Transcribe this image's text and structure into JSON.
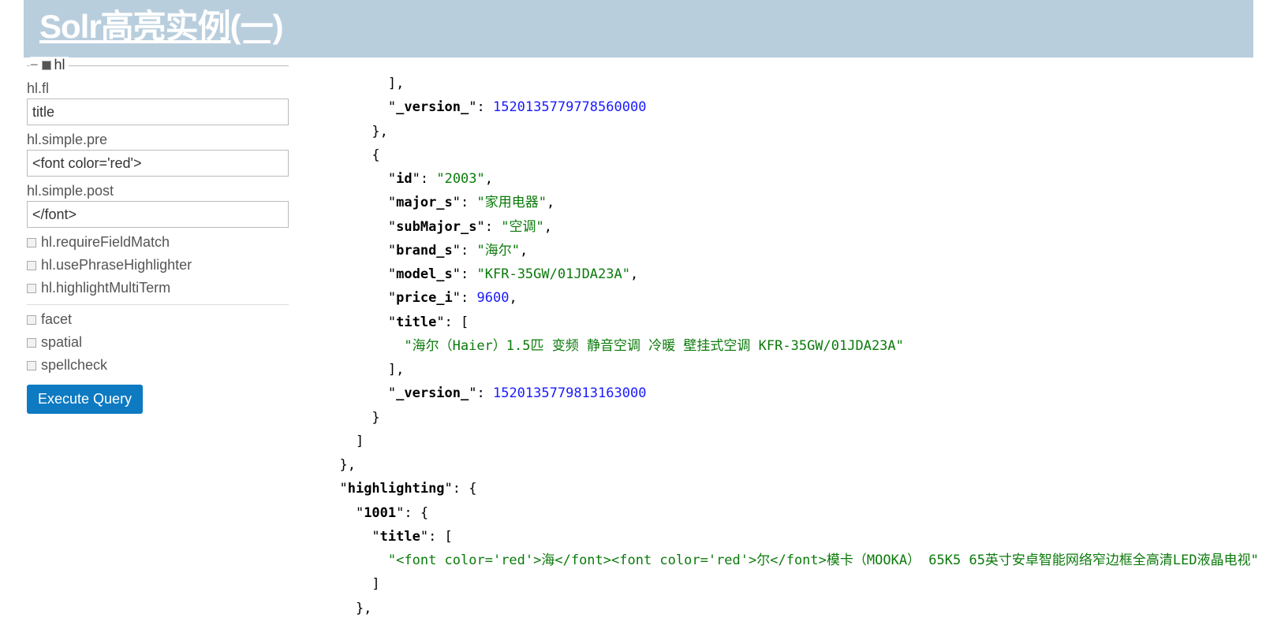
{
  "banner": {
    "title": "Solr高亮实例(一)"
  },
  "sidebar": {
    "hl_section": "hl",
    "labels": {
      "hl_fl": "hl.fl",
      "hl_simple_pre": "hl.simple.pre",
      "hl_simple_post": "hl.simple.post",
      "hl_requireFieldMatch": "hl.requireFieldMatch",
      "hl_usePhraseHighlighter": "hl.usePhraseHighlighter",
      "hl_highlightMultiTerm": "hl.highlightMultiTerm",
      "facet": "facet",
      "spatial": "spatial",
      "spellcheck": "spellcheck"
    },
    "values": {
      "hl_fl": "title",
      "hl_simple_pre": "<font color='red'>",
      "hl_simple_post": "</font>"
    },
    "exec_label": "Execute Query"
  },
  "json": {
    "doc1_version_key": "_version_",
    "doc1_version_val": "1520135779778560000",
    "doc2": {
      "id_k": "id",
      "id_v": "2003",
      "major_k": "major_s",
      "major_v": "家用电器",
      "submajor_k": "subMajor_s",
      "submajor_v": "空调",
      "brand_k": "brand_s",
      "brand_v": "海尔",
      "model_k": "model_s",
      "model_v": "KFR-35GW/01JDA23A",
      "price_k": "price_i",
      "price_v": "9600",
      "title_k": "title",
      "title_arr0": "海尔（Haier）1.5匹 变频 静音空调 冷暖 壁挂式空调 KFR-35GW/01JDA23A",
      "version_k": "_version_",
      "version_v": "1520135779813163000"
    },
    "highlighting_k": "highlighting",
    "hl_id": "1001",
    "hl_title_k": "title",
    "hl_title_v": "<font color='red'>海</font><font color='red'>尔</font>模卡（MOOKA） 65K5 65英寸安卓智能网络窄边框全高清LED液晶电视"
  }
}
